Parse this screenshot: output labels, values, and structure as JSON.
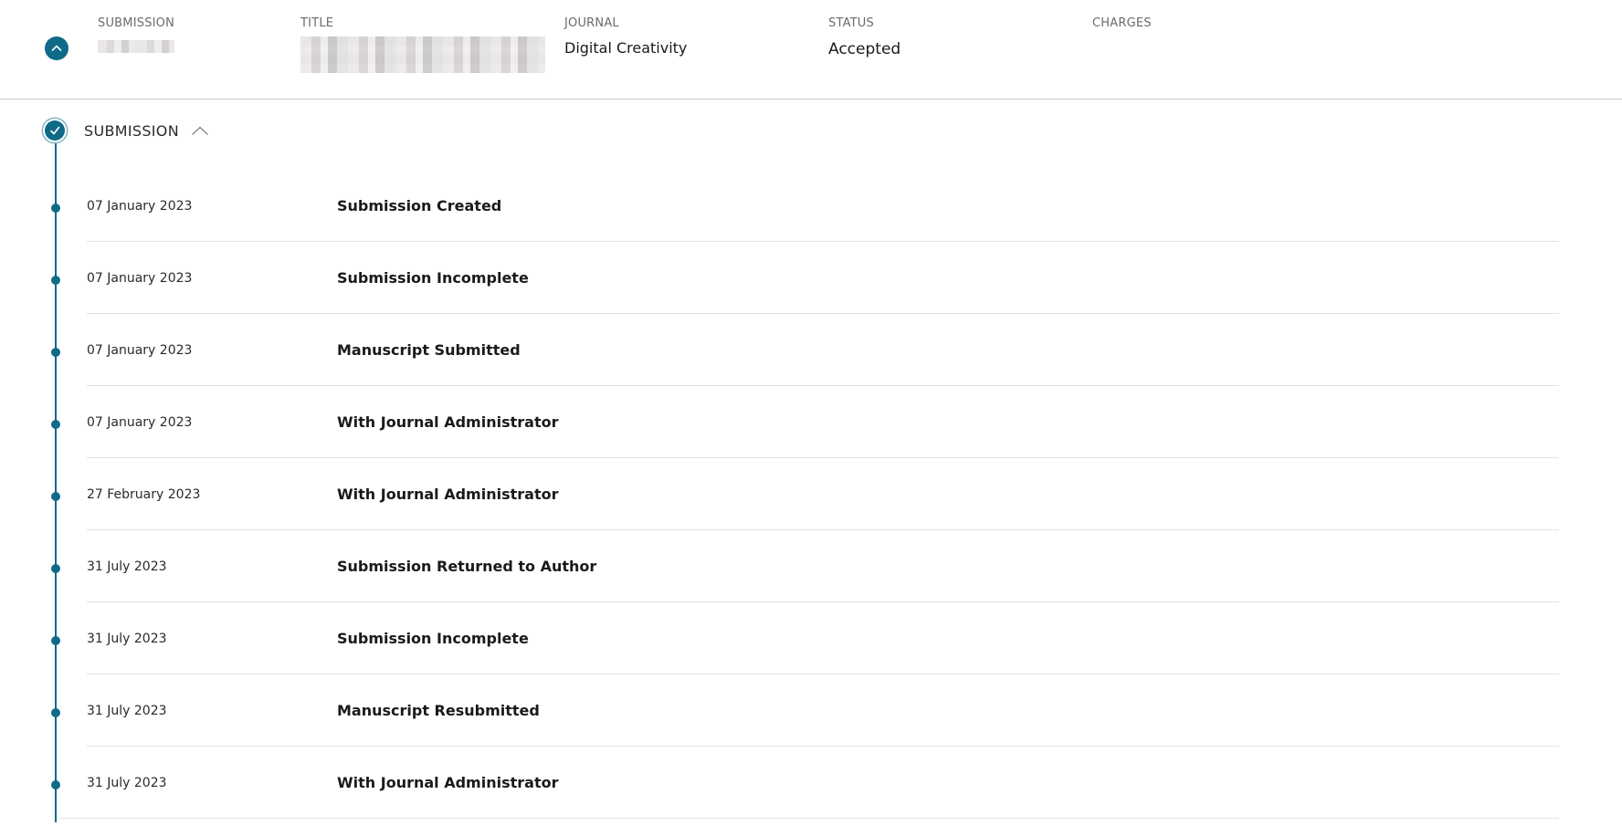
{
  "summary": {
    "columns": {
      "submission_label": "SUBMISSION",
      "title_label": "TITLE",
      "journal_label": "JOURNAL",
      "status_label": "STATUS",
      "charges_label": "CHARGES"
    },
    "journal": "Digital Creativity",
    "status": "Accepted",
    "charges": ""
  },
  "timeline": {
    "section_title": "SUBMISSION",
    "events": [
      {
        "date": "07 January 2023",
        "name": "Submission Created"
      },
      {
        "date": "07 January 2023",
        "name": "Submission Incomplete"
      },
      {
        "date": "07 January 2023",
        "name": "Manuscript Submitted"
      },
      {
        "date": "07 January 2023",
        "name": "With Journal Administrator"
      },
      {
        "date": "27 February 2023",
        "name": "With Journal Administrator"
      },
      {
        "date": "31 July 2023",
        "name": "Submission Returned to Author"
      },
      {
        "date": "31 July 2023",
        "name": "Submission Incomplete"
      },
      {
        "date": "31 July 2023",
        "name": "Manuscript Resubmitted"
      },
      {
        "date": "31 July 2023",
        "name": "With Journal Administrator"
      }
    ]
  },
  "colors": {
    "accent": "#0f6a88",
    "divider": "#e1e1e1",
    "label": "#6b6b6b"
  },
  "icons": {
    "collapse_toggle": "chevron-up-icon",
    "section_status": "check-icon",
    "section_toggle": "chevron-up-icon"
  }
}
